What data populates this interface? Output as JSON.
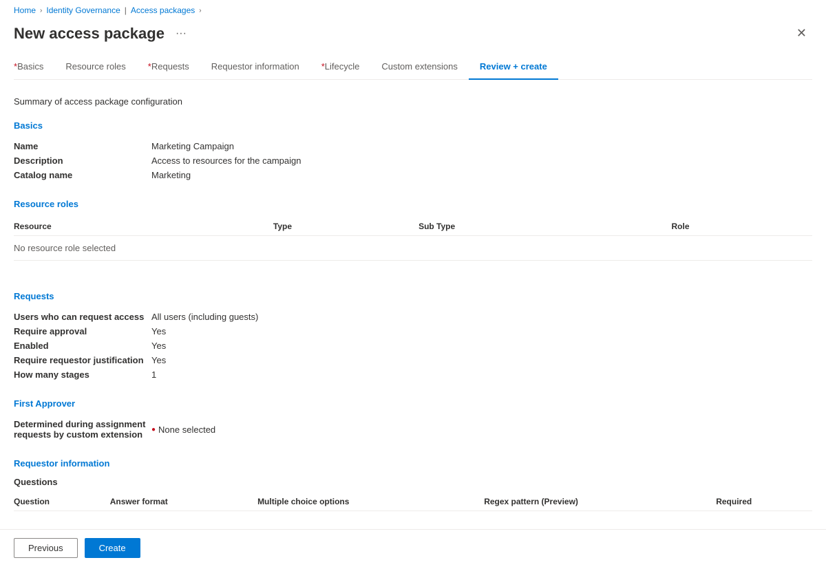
{
  "breadcrumb": {
    "home": "Home",
    "identity_governance": "Identity Governance",
    "access_packages": "Access packages"
  },
  "page": {
    "title": "New access package",
    "summary": "Summary of access package configuration"
  },
  "tabs": [
    {
      "label": "Basics",
      "required": true,
      "active": false
    },
    {
      "label": "Resource roles",
      "required": false,
      "active": false
    },
    {
      "label": "Requests",
      "required": true,
      "active": false
    },
    {
      "label": "Requestor information",
      "required": false,
      "active": false
    },
    {
      "label": "Lifecycle",
      "required": true,
      "active": false
    },
    {
      "label": "Custom extensions",
      "required": false,
      "active": false
    },
    {
      "label": "Review + create",
      "required": false,
      "active": true
    }
  ],
  "sections": {
    "basics": {
      "heading": "Basics",
      "fields": [
        {
          "label": "Name",
          "value": "Marketing Campaign"
        },
        {
          "label": "Description",
          "value": "Access to resources for the campaign"
        },
        {
          "label": "Catalog name",
          "value": "Marketing"
        }
      ]
    },
    "resource_roles": {
      "heading": "Resource roles",
      "columns": [
        "Resource",
        "Type",
        "Sub Type",
        "Role"
      ],
      "no_data": "No resource role selected"
    },
    "requests": {
      "heading": "Requests",
      "fields": [
        {
          "label": "Users who can request access",
          "value": "All users (including guests)"
        },
        {
          "label": "Require approval",
          "value": "Yes"
        },
        {
          "label": "Enabled",
          "value": "Yes"
        },
        {
          "label": "Require requestor justification",
          "value": "Yes"
        },
        {
          "label": "How many stages",
          "value": "1"
        }
      ]
    },
    "first_approver": {
      "heading": "First Approver",
      "label": "Determined during assignment requests by custom extension",
      "value": "None selected"
    },
    "requestor_information": {
      "heading": "Requestor information",
      "questions_label": "Questions",
      "columns": [
        "Question",
        "Answer format",
        "Multiple choice options",
        "Regex pattern (Preview)",
        "Required"
      ]
    }
  },
  "buttons": {
    "previous": "Previous",
    "create": "Create"
  },
  "icons": {
    "chevron": "›",
    "ellipsis": "···",
    "close": "✕",
    "error": "●"
  }
}
